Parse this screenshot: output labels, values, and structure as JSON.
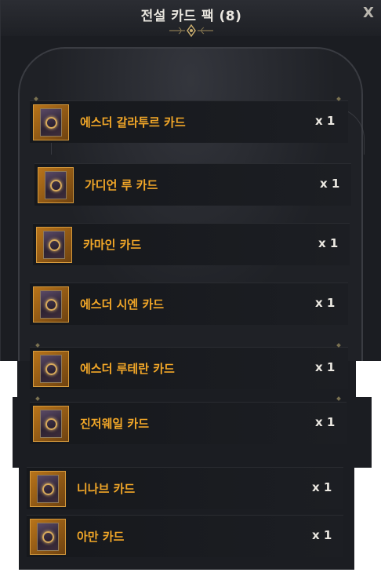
{
  "window": {
    "title": "전설 카드 팩 (8)",
    "close_label": "X"
  },
  "cards": [
    {
      "name": "에스더 갈라투르 카드",
      "qty": "x 1"
    },
    {
      "name": "가디언 루 카드",
      "qty": "x 1"
    },
    {
      "name": "카마인 카드",
      "qty": "x 1"
    },
    {
      "name": "에스더 시엔 카드",
      "qty": "x 1"
    },
    {
      "name": "에스더 루테란 카드",
      "qty": "x 1"
    },
    {
      "name": "진저웨일 카드",
      "qty": "x 1"
    },
    {
      "name": "니나브 카드",
      "qty": "x 1"
    },
    {
      "name": "아만 카드",
      "qty": "x 1"
    }
  ],
  "colors": {
    "card_name": "#f2a728",
    "quantity": "#ece9e2",
    "icon_frame": "#b8741a",
    "panel_bg": "#1b1d22"
  },
  "icons": {
    "card_icon": "legendary-card-icon",
    "close": "close-icon"
  }
}
